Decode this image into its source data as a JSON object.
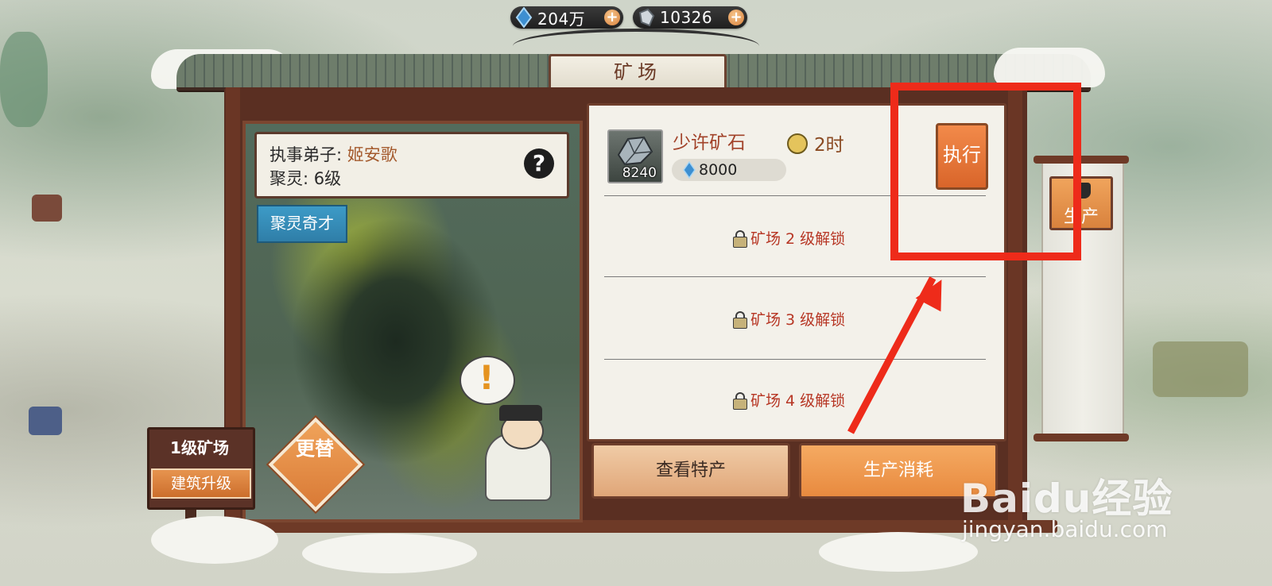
{
  "currency": [
    {
      "icon": "spirit-stone-icon",
      "value": "204万"
    },
    {
      "icon": "ore-crystal-icon",
      "value": "10326"
    }
  ],
  "title": "矿场",
  "info_card": {
    "steward_label": "执事弟子:",
    "steward_name": "姬安歌",
    "gather_label": "聚灵:",
    "gather_level": "6级"
  },
  "talent_tag": "聚灵奇才",
  "swap_button": "更替",
  "level_sign": {
    "title": "1级矿场",
    "upgrade": "建筑升级"
  },
  "production": {
    "item_name": "少许矿石",
    "item_count": "8240",
    "duration": "2时",
    "cost": "8000",
    "execute": "执行"
  },
  "locked_slots": [
    "矿场 2 级解锁",
    "矿场 3 级解锁",
    "矿场 4 级解锁"
  ],
  "tabs": {
    "view": "查看特产",
    "consume": "生产消耗"
  },
  "side_button": "生产",
  "watermark": {
    "main": "Baidu经验",
    "sub": "jingyan.baidu.com"
  },
  "colors": {
    "annotation": "#ee2b1a",
    "accent_orange": "#e88a3f",
    "lock_red": "#b73725"
  }
}
